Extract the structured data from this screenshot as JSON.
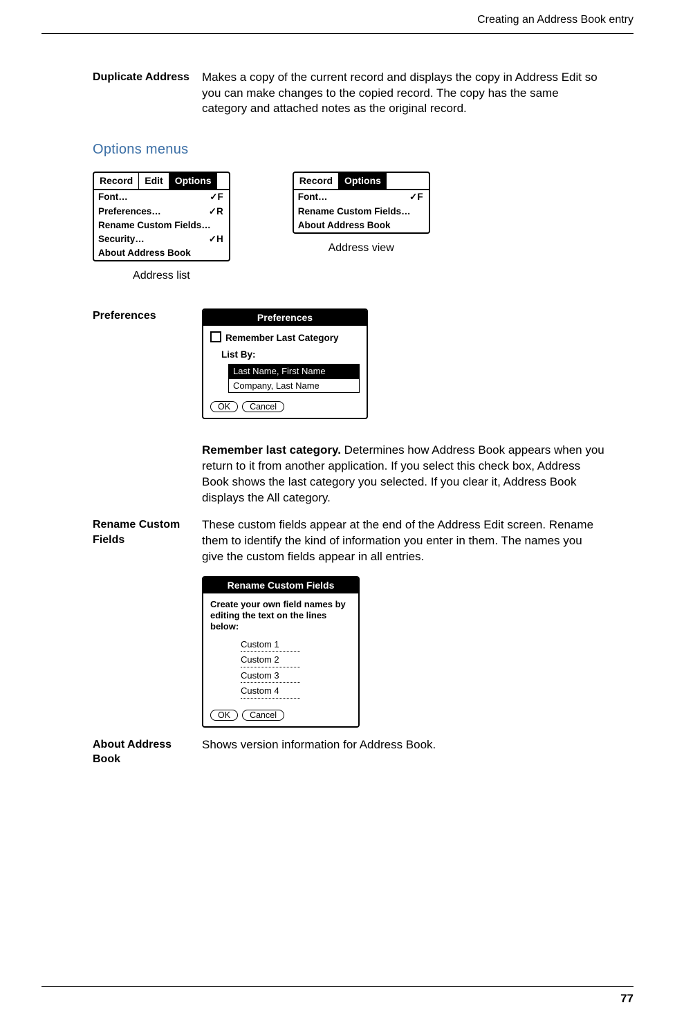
{
  "header": {
    "running": "Creating an Address Book entry"
  },
  "dup": {
    "term": "Duplicate Address",
    "body": "Makes a copy of the current record and displays the copy in Address Edit so you can make changes to the copied record. The copy has the same category and attached notes as the original record."
  },
  "section_title": "Options menus",
  "menubar1": {
    "bar": [
      "Record",
      "Edit",
      "Options"
    ],
    "active_index": 2,
    "items": [
      {
        "label": "Font…",
        "shortcut": "F"
      },
      {
        "label": "Preferences…",
        "shortcut": "R"
      },
      {
        "label": "Rename Custom Fields…"
      },
      {
        "label": "Security…",
        "shortcut": "H"
      },
      {
        "label": "About Address Book"
      }
    ],
    "caption": "Address list"
  },
  "menubar2": {
    "bar": [
      "Record",
      "Options"
    ],
    "active_index": 1,
    "items": [
      {
        "label": "Font…",
        "shortcut": "F"
      },
      {
        "label": "Rename Custom Fields…"
      },
      {
        "label": "About Address Book"
      }
    ],
    "caption": "Address view"
  },
  "prefs": {
    "term": "Preferences",
    "dialog_title": "Preferences",
    "checkbox_label": "Remember Last Category",
    "listby_label": "List By:",
    "options": [
      "Last Name, First Name",
      "Company, Last Name"
    ],
    "ok": "OK",
    "cancel": "Cancel",
    "remember_bold": "Remember last category.",
    "remember_text": " Determines how Address Book appears when you return to it from another application. If you select this check box, Address Book shows the last category you selected. If you clear it, Address Book displays the All category."
  },
  "rename": {
    "term": "Rename Custom Fields",
    "body": "These custom fields appear at the end of the Address Edit screen. Rename them to identify the kind of information you enter in them. The names you give the custom fields appear in all entries.",
    "dialog_title": "Rename Custom Fields",
    "note": "Create your own field names by editing the text on the lines below:",
    "customs": [
      "Custom 1",
      "Custom 2",
      "Custom 3",
      "Custom 4"
    ],
    "ok": "OK",
    "cancel": "Cancel"
  },
  "about": {
    "term": "About Address Book",
    "body": "Shows version information for Address Book."
  },
  "page_number": "77",
  "shortcut_prefix": "✓"
}
